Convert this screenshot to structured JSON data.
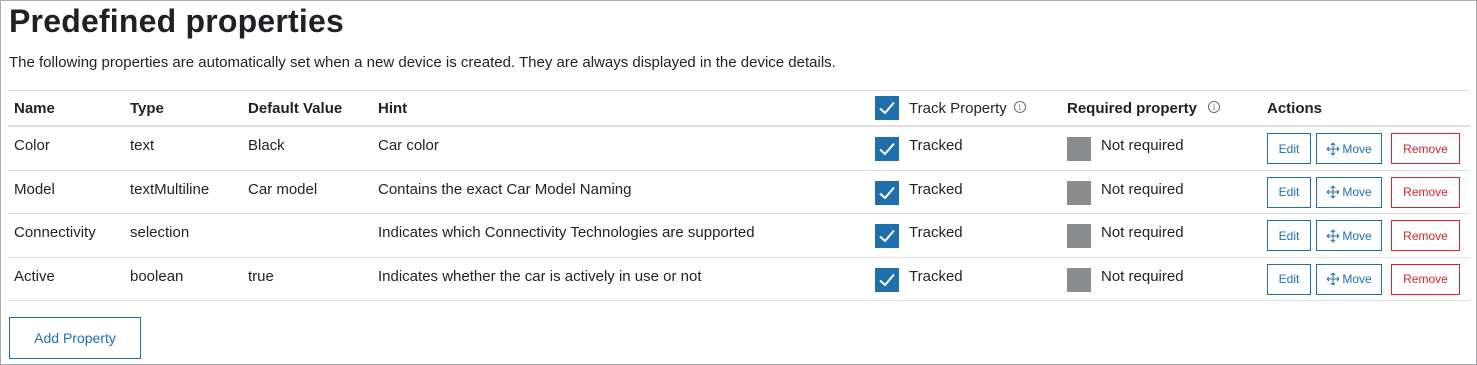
{
  "page": {
    "title": "Predefined properties",
    "description": "The following properties are automatically set when a new device is created. They are always displayed in the device details."
  },
  "table": {
    "headers": {
      "name": "Name",
      "type": "Type",
      "default_value": "Default Value",
      "hint": "Hint",
      "track_property": "Track Property",
      "required_property": "Required property",
      "actions": "Actions"
    },
    "header_track_checked": true,
    "rows": [
      {
        "name": "Color",
        "type": "text",
        "default_value": "Black",
        "hint": "Car color",
        "tracked": true,
        "tracked_label": "Tracked",
        "required": false,
        "required_label": "Not required"
      },
      {
        "name": "Model",
        "type": "textMultiline",
        "default_value": "Car model",
        "hint": "Contains the exact Car Model Naming",
        "tracked": true,
        "tracked_label": "Tracked",
        "required": false,
        "required_label": "Not required"
      },
      {
        "name": "Connectivity",
        "type": "selection",
        "default_value": "",
        "hint": "Indicates which Connectivity Technologies are supported",
        "tracked": true,
        "tracked_label": "Tracked",
        "required": false,
        "required_label": "Not required"
      },
      {
        "name": "Active",
        "type": "boolean",
        "default_value": "true",
        "hint": "Indicates whether the car is actively in use or not",
        "tracked": true,
        "tracked_label": "Tracked",
        "required": false,
        "required_label": "Not required"
      }
    ],
    "actions": {
      "edit": "Edit",
      "move": "Move",
      "remove": "Remove"
    }
  },
  "add_property_label": "Add Property",
  "icons": {
    "info": "info-icon",
    "check": "checkmark-icon",
    "move": "move-arrows-icon"
  },
  "colors": {
    "primary": "#1f6fad",
    "danger": "#d0262f",
    "unchecked": "#8a8c8e"
  }
}
